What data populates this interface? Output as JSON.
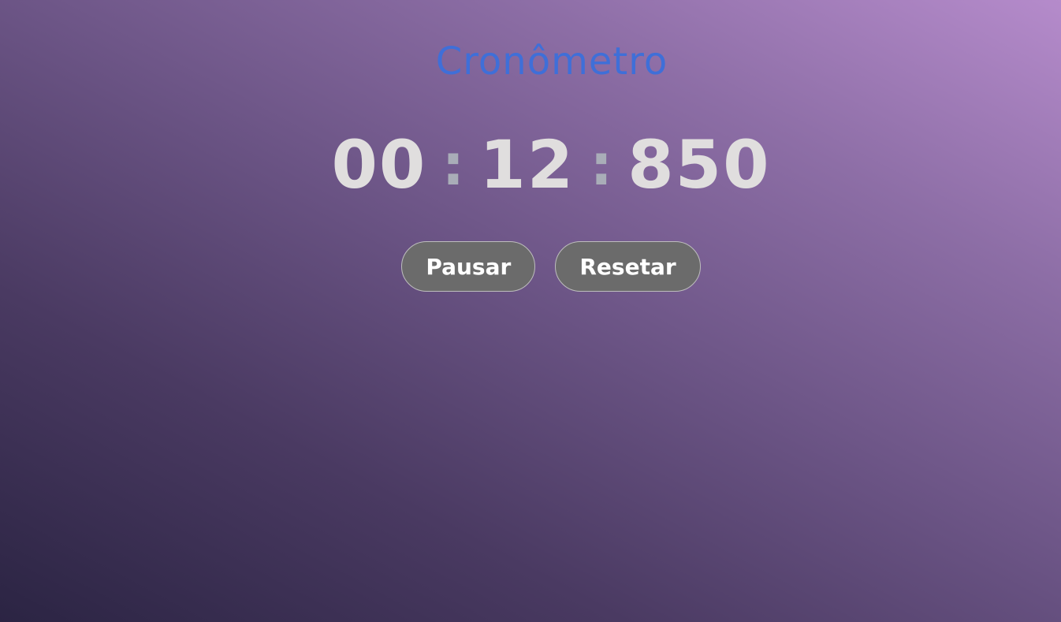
{
  "app": {
    "title": "Cronômetro"
  },
  "timer": {
    "minutes": "00",
    "seconds": "12",
    "milliseconds": "850",
    "separator": ":"
  },
  "controls": {
    "pause_label": "Pausar",
    "reset_label": "Resetar"
  },
  "colors": {
    "title": "#3f6fd8",
    "digits": "#e0dede",
    "separator": "#a9adb8",
    "button_bg": "#6b6b6b",
    "button_text": "#ffffff"
  }
}
